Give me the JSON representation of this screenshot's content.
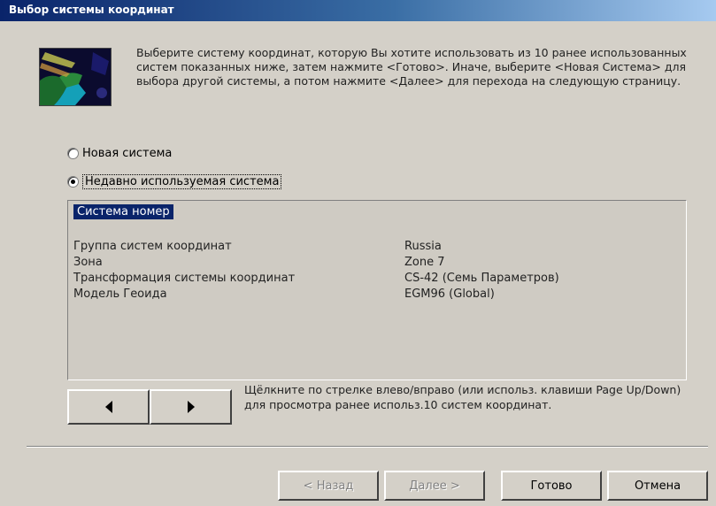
{
  "window": {
    "title": "Выбор системы координат"
  },
  "intro_text": "Выберите систему координат, которую Вы хотите использовать из 10 ранее использованных систем показанных ниже, затем нажмите <Готово>. Иначе, выберите <Новая Система> для выбора другой системы, а потом нажмите <Далее> для перехода на следующую страницу.",
  "options": {
    "new_system": "Новая система",
    "recent_system": "Недавно используемая система",
    "selected": "recent_system"
  },
  "group": {
    "header": "Система номер",
    "rows": [
      {
        "label": "Группа систем координат",
        "value": "Russia"
      },
      {
        "label": "Зона",
        "value": "Zone 7"
      },
      {
        "label": "Трансформация системы координат",
        "value": "CS-42 (Семь Параметров)"
      },
      {
        "label": "Модель Геоида",
        "value": "EGM96 (Global)"
      }
    ]
  },
  "nav": {
    "left_icon": "arrow-left-icon",
    "right_icon": "arrow-right-icon",
    "hint": "Щёлкните по стрелке влево/вправо (или использ. клавиши Page Up/Down) для просмотра ранее использ.10 систем координат."
  },
  "buttons": {
    "back": "< Назад",
    "next": "Далее >",
    "finish": "Готово",
    "cancel": "Отмена"
  },
  "colors": {
    "title_bar": "#0a246a",
    "dialog_bg": "#d4d0c8",
    "selection": "#0a246a"
  },
  "icons": {
    "header_image": "globe-map-icon"
  }
}
